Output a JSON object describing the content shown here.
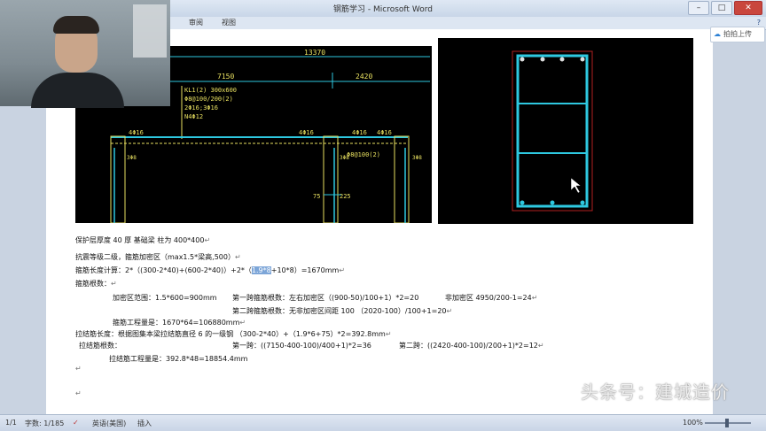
{
  "window": {
    "title": "钢筋学习 - Microsoft Word",
    "controls": [
      "–",
      "□",
      "✕"
    ]
  },
  "ribbon": {
    "tabs": [
      "审阅",
      "视图"
    ],
    "help": "?"
  },
  "upload_button": {
    "label": "拍拍上传",
    "icon": "cloud-icon"
  },
  "cad_drawing": {
    "dims": {
      "total": "13370",
      "span1": "7150",
      "span2": "2420",
      "d75": "75",
      "d225": "225"
    },
    "beam_label": [
      "KL1(2) 300x600",
      "Φ8@100/200(2)",
      "2Φ16;3Φ16",
      "N4Φ12"
    ],
    "column_labels": [
      "4Φ16",
      "4Φ16",
      "4Φ16",
      "4Φ16"
    ],
    "side_labels": [
      "3Φ8",
      "3Φ8",
      "3Φ8",
      "Φ8@100(2)"
    ]
  },
  "document": {
    "line1": "保护层厚度 40 厚 基础梁 柱为 400*400",
    "line2": "抗震等级二级，箍筋加密区（max1.5*梁高,500）",
    "line3_pre": "箍筋长度计算：2*（(300-2*40)+(600-2*40)）+2*（",
    "line3_hl": "1.9*8",
    "line3_post": "+10*8）=1670mm",
    "line4": "箍筋根数：",
    "line5a": "加密区范围：1.5*600=900mm",
    "line5b": "第一跨箍筋根数：左右加密区（(900-50)/100+1）*2=20",
    "line5c": "非加密区 4950/200-1=24",
    "line6": "第二跨箍筋根数：无非加密区间距 100 （2020-100）/100+1=20",
    "line7": "箍筋工程量是：1670*64=106880mm",
    "line8": "拉结筋长度：根据图集本梁拉结筋直径 6 的一级钢 （300-2*40）+（1.9*6+75）*2=392.8mm",
    "line9a": "拉结筋根数：",
    "line9b": "第一跨：((7150-400-100)/400+1)*2=36",
    "line9c": "第二跨：((2420-400-100)/200+1)*2=12",
    "line10": "拉结筋工程量是：392.8*48=18854.4mm",
    "para_mark": "↵"
  },
  "statusbar": {
    "page": "1/1",
    "words": "字数: 1/185",
    "language": "英语(美国)",
    "mode": "插入",
    "zoom": "100%"
  },
  "watermark": "头条号：建城造价",
  "colors": {
    "cad_cyan": "#2ec8e0",
    "cad_yellow": "#e8e060",
    "cad_red": "#b02020",
    "highlight": "#7da6d8"
  }
}
